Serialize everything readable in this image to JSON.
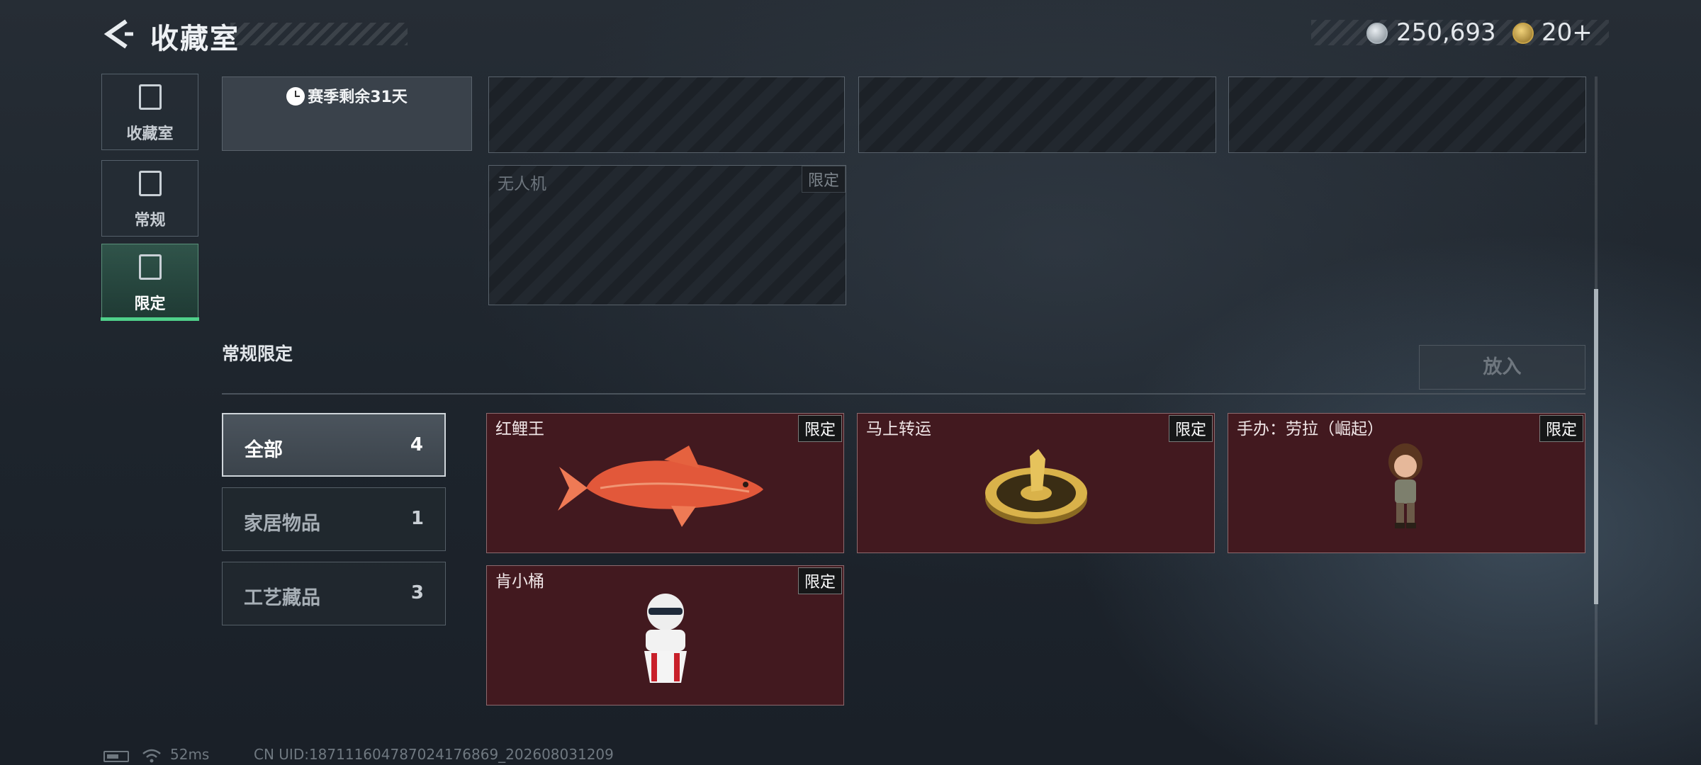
{
  "header": {
    "title": "收藏室",
    "currency1_value": "250,693",
    "currency2_value": "20+"
  },
  "sidebar": {
    "items": [
      {
        "label": "收藏室",
        "icon": "collection-icon"
      },
      {
        "label": "常规",
        "icon": "regular-icon"
      },
      {
        "label": "限定",
        "icon": "limited-icon",
        "selected": true
      }
    ]
  },
  "season": {
    "text": "赛季剩余31天"
  },
  "upper_slots": [
    {
      "name": "",
      "tag": ""
    },
    {
      "name": "",
      "tag": ""
    },
    {
      "name": "",
      "tag": ""
    },
    {
      "name": "无人机",
      "tag": "限定"
    }
  ],
  "section": {
    "title": "常规限定",
    "place_button": "放入"
  },
  "filters": [
    {
      "label": "全部",
      "count": "4",
      "selected": true
    },
    {
      "label": "家居物品",
      "count": "1"
    },
    {
      "label": "工艺藏品",
      "count": "3"
    }
  ],
  "items": [
    {
      "name": "红鲤王",
      "tag": "限定",
      "icon": "koi-fish-icon"
    },
    {
      "name": "马上转运",
      "tag": "限定",
      "icon": "lucky-wheel-icon"
    },
    {
      "name": "手办：劳拉（崛起）",
      "tag": "限定",
      "icon": "figurine-icon"
    },
    {
      "name": "肯小桶",
      "tag": "限定",
      "icon": "kfc-bucket-icon"
    }
  ],
  "status": {
    "ping": "52ms",
    "uid": "CN UID:18711160478702417686​9_202608031209"
  },
  "colors": {
    "accent_green": "#4fd08a",
    "card_bg": "#42191f"
  }
}
